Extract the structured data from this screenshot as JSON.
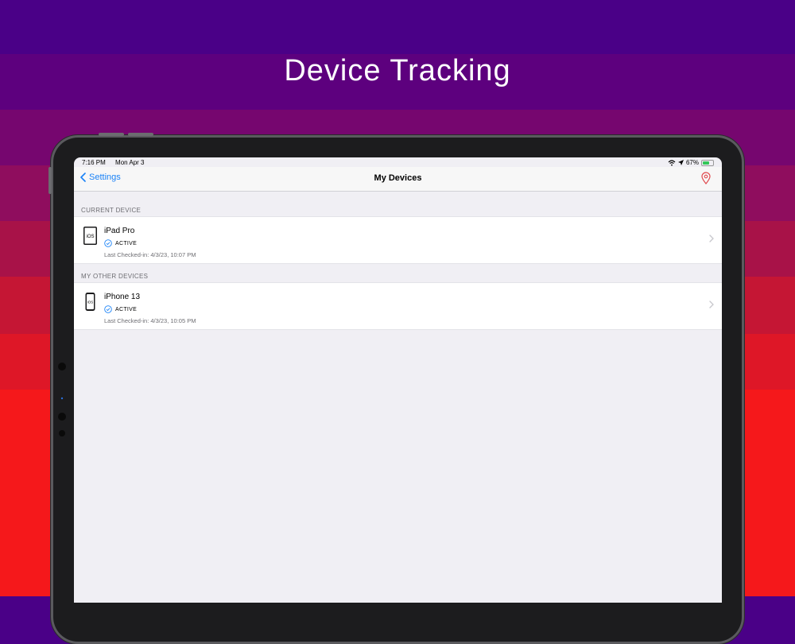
{
  "headline": "Device Tracking",
  "status_bar": {
    "time": "7:16 PM",
    "date": "Mon Apr 3",
    "battery": "67%"
  },
  "nav": {
    "back_label": "Settings",
    "title": "My Devices"
  },
  "sections": {
    "current": {
      "header": "CURRENT DEVICE",
      "device": {
        "name": "iPad Pro",
        "icon_label": "iOS",
        "status": "ACTIVE",
        "last_checked": "Last Checked-in: 4/3/23, 10:07 PM"
      }
    },
    "other": {
      "header": "MY OTHER DEVICES",
      "device": {
        "name": "iPhone 13",
        "icon_label": "iOS",
        "status": "ACTIVE",
        "last_checked": "Last Checked-in: 4/3/23, 10:05 PM"
      }
    }
  },
  "colors": {
    "accent": "#1a82f7",
    "pin": "#e0474c",
    "active_check": "#1a82f7"
  },
  "icons": [
    "chevron-left-icon",
    "location-pin-icon",
    "ipad-icon",
    "iphone-icon",
    "check-circle-icon",
    "chevron-right-icon",
    "wifi-icon",
    "location-arrow-icon",
    "battery-icon"
  ]
}
